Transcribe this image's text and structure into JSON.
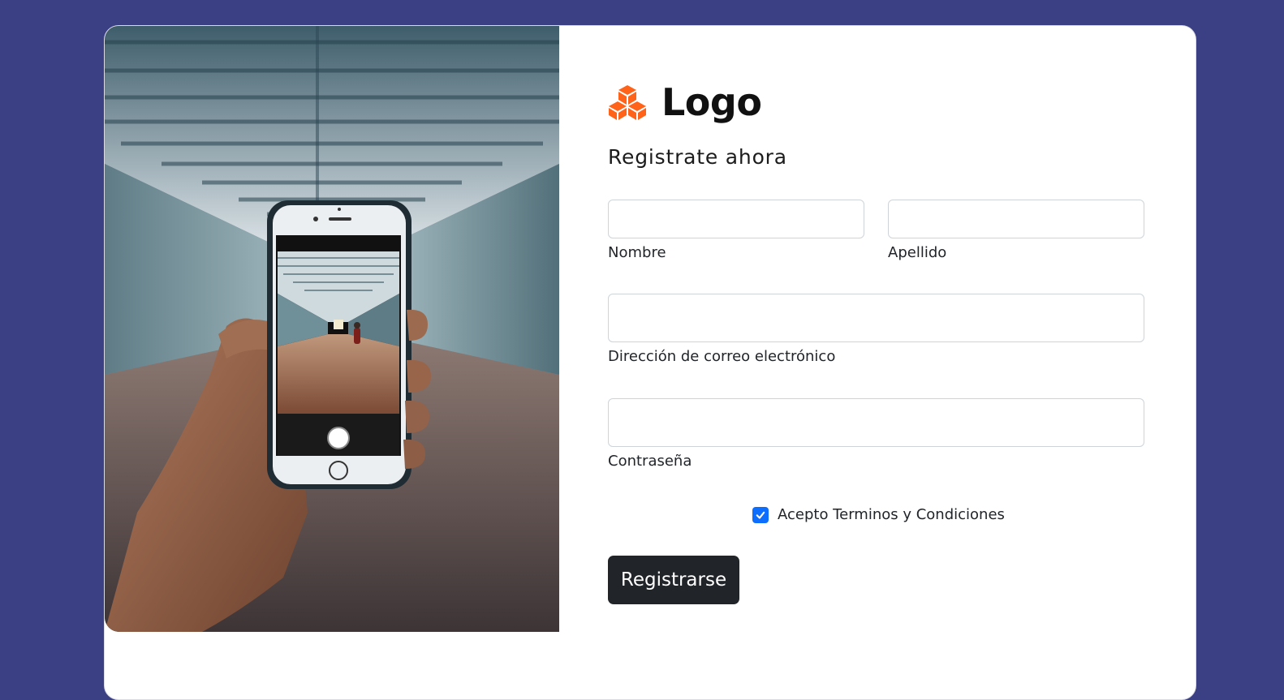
{
  "colors": {
    "page_background": "#3b3f84",
    "card_background": "#ffffff",
    "brand_icon": "#ff6219",
    "checkbox_checked": "#0d6efd",
    "button_background": "#212529"
  },
  "hero_image": {
    "icon": "photo-phone-in-hand-corridor"
  },
  "brand": {
    "icon": "cubes-icon",
    "name": "Logo"
  },
  "form": {
    "subtitle": "Registrate ahora",
    "fields": {
      "nombre": {
        "label": "Nombre",
        "value": ""
      },
      "apellido": {
        "label": "Apellido",
        "value": ""
      },
      "email": {
        "label": "Dirección de correo electrónico",
        "value": ""
      },
      "password": {
        "label": "Contraseña",
        "value": ""
      }
    },
    "terms": {
      "checked": true,
      "label": "Acepto Terminos y Condiciones"
    },
    "submit_label": "Registrarse"
  }
}
